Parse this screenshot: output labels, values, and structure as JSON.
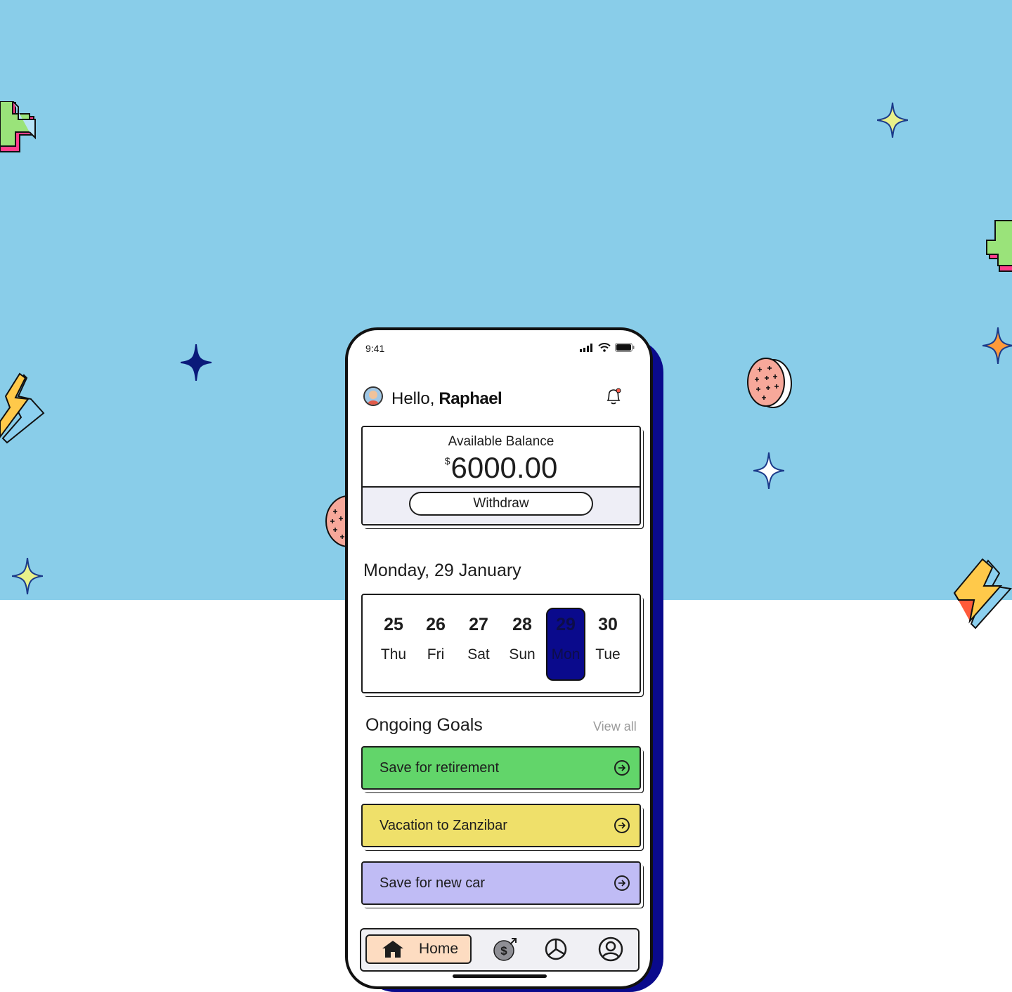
{
  "status_bar": {
    "time": "9:41"
  },
  "header": {
    "greeting": "Hello,",
    "name": "Raphael"
  },
  "balance": {
    "label": "Available Balance",
    "currency": "$",
    "amount": "6000.00",
    "withdraw_label": "Withdraw"
  },
  "date_title": "Monday, 29 January",
  "calendar": {
    "days": [
      {
        "num": "25",
        "weekday": "Thu"
      },
      {
        "num": "26",
        "weekday": "Fri"
      },
      {
        "num": "27",
        "weekday": "Sat"
      },
      {
        "num": "28",
        "weekday": "Sun"
      },
      {
        "num": "29",
        "weekday": "Mon",
        "selected": true
      },
      {
        "num": "30",
        "weekday": "Tue"
      }
    ]
  },
  "goals": {
    "title": "Ongoing Goals",
    "view_all": "View all",
    "items": [
      {
        "label": "Save for retirement",
        "color": "#62d56a"
      },
      {
        "label": "Vacation to Zanzibar",
        "color": "#efe06a"
      },
      {
        "label": "Save for new car",
        "color": "#c0bcf5"
      }
    ]
  },
  "tabbar": {
    "home_label": "Home",
    "icons": [
      "home-icon",
      "money-transfer-icon",
      "pie-chart-icon",
      "profile-icon"
    ]
  },
  "colors": {
    "sky": "#89cde9",
    "accent_navy": "#0a0a8c",
    "home_tab": "#fddcc1"
  }
}
